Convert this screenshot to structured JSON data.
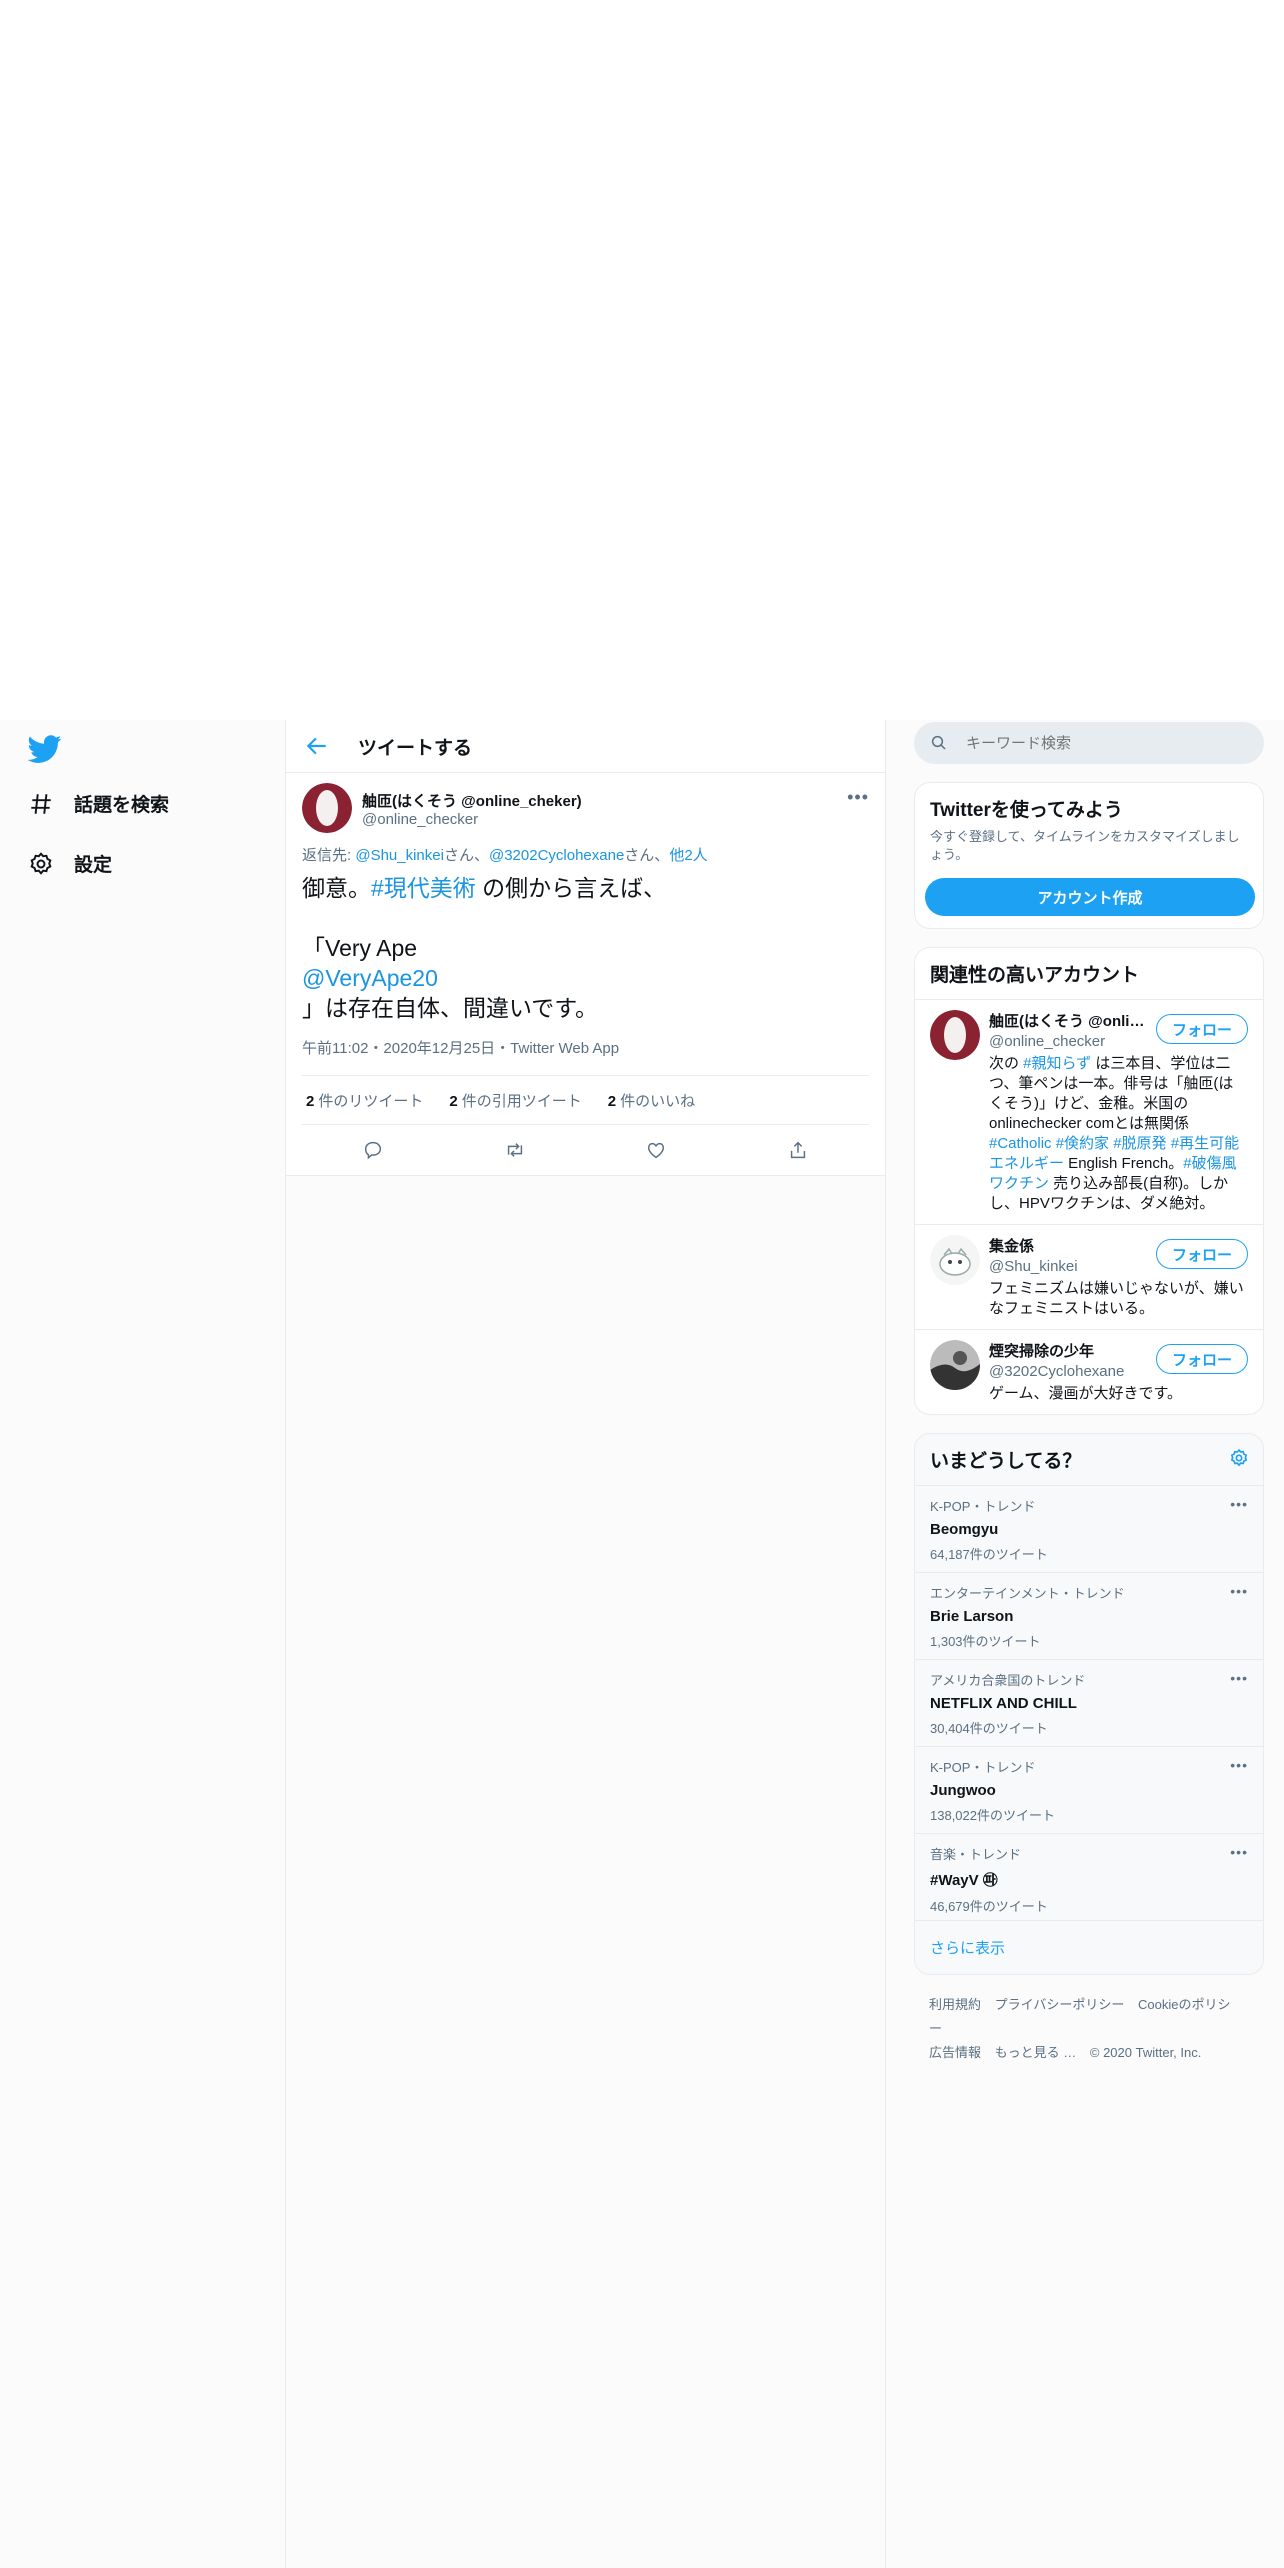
{
  "nav": {
    "explore_label": "話題を検索",
    "settings_label": "設定"
  },
  "header": {
    "title": "ツイートする"
  },
  "tweet": {
    "display_name": "舳匝(はくそう @online_cheker)",
    "handle": "@online_checker",
    "reply_prefix": "返信先: ",
    "reply_user1": "@Shu_kinkei",
    "reply_sep1": "さん、",
    "reply_user2": "@3202Cyclohexane",
    "reply_sep2": "さん、",
    "reply_others": "他2人",
    "body_text1": "御意。",
    "body_hashtag": "#現代美術",
    "body_text2": " の側から言えば、",
    "body_line3": "「Very Ape",
    "body_mention": "@VeryApe20",
    "body_line5": "」は存在自体、間違いです。",
    "meta": "午前11:02・2020年12月25日・Twitter Web App",
    "retweet_count": "2",
    "retweet_label": "件のリツイート",
    "quote_count": "2",
    "quote_label": "件の引用ツイート",
    "like_count": "2",
    "like_label": "件のいいね"
  },
  "search": {
    "placeholder": "キーワード検索"
  },
  "join": {
    "title": "Twitterを使ってみよう",
    "desc": "今すぐ登録して、タイムラインをカスタマイズしましょう。",
    "button": "アカウント作成"
  },
  "related": {
    "title": "関連性の高いアカウント",
    "follow_label": "フォロー",
    "accounts": [
      {
        "name": "舳匝(はくそう @onlin...",
        "handle": "@online_checker",
        "bio_a": "次の ",
        "bio_tag1": "#親知らず",
        "bio_b": " は三本目、学位は二つ、筆ペンは一本。俳号は「舳匝(はくそう)」けど、金稚。米国のonlinechecker comとは無関係 ",
        "bio_tags2": "#Catholic #倹約家 #脱原発 #再生可能エネルギー",
        "bio_c": " English French。",
        "bio_tag3": "#破傷風ワクチン",
        "bio_d": " 売り込み部長(自称)。しかし、HPVワクチンは、ダメ絶対。"
      },
      {
        "name": "集金係",
        "handle": "@Shu_kinkei",
        "bio": "フェミニズムは嫌いじゃないが、嫌いなフェミニストはいる。"
      },
      {
        "name": "煙突掃除の少年",
        "handle": "@3202Cyclohexane",
        "bio": "ゲーム、漫画が大好きです。"
      }
    ]
  },
  "trends": {
    "title": "いまどうしてる？",
    "items": [
      {
        "category": "K-POP・トレンド",
        "name": "Beomgyu",
        "count": "64,187件のツイート"
      },
      {
        "category": "エンターテインメント・トレンド",
        "name": "Brie Larson",
        "count": "1,303件のツイート"
      },
      {
        "category": "アメリカ合衆国のトレンド",
        "name": "NETFLIX AND CHILL",
        "count": "30,404件のツイート"
      },
      {
        "category": "K-POP・トレンド",
        "name": "Jungwoo",
        "count": "138,022件のツイート"
      },
      {
        "category": "音楽・トレンド",
        "name": "#WayV ㉺",
        "count": "46,679件のツイート"
      }
    ],
    "show_more": "さらに表示"
  },
  "footer": {
    "terms": "利用規約",
    "privacy": "プライバシーポリシー",
    "cookie": "Cookieのポリシー",
    "ads": "広告情報",
    "more": "もっと見る …",
    "copyright": "© 2020 Twitter, Inc."
  },
  "colors": {
    "accent": "#1da1f2",
    "link": "#1b95e0",
    "secondary_text": "#5b7083"
  }
}
